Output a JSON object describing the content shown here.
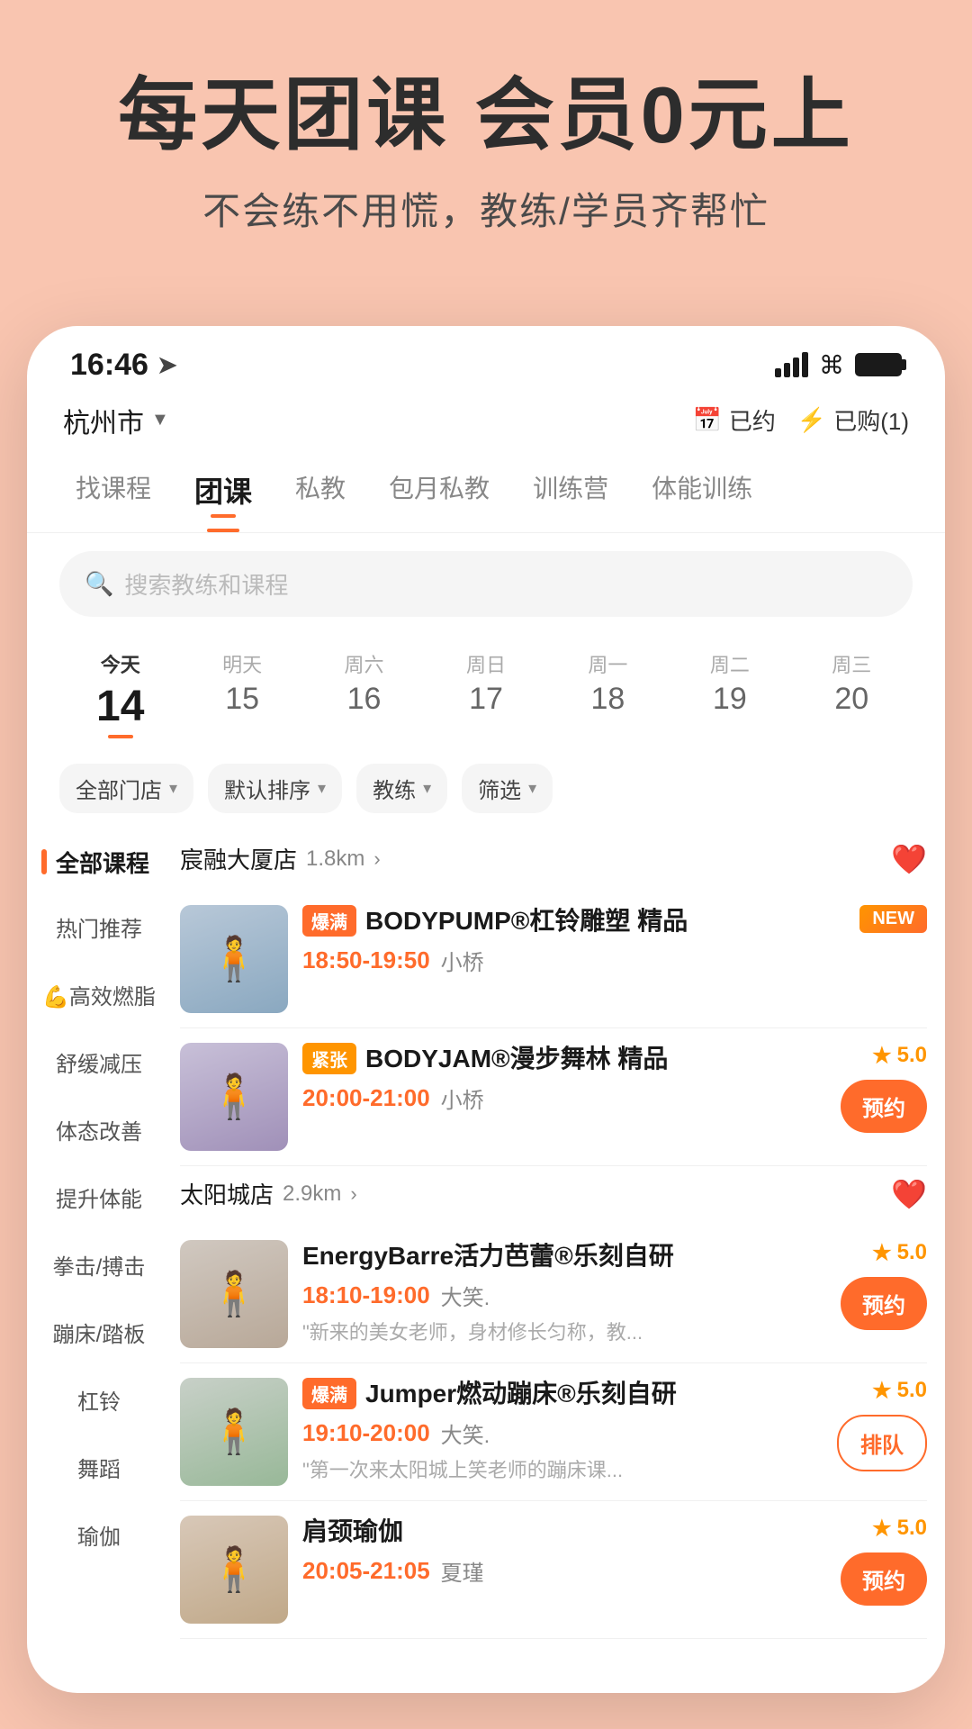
{
  "hero": {
    "title": "每天团课 会员0元上",
    "subtitle": "不会练不用慌，教练/学员齐帮忙"
  },
  "status_bar": {
    "time": "16:46",
    "nav_icon": "➤"
  },
  "top_nav": {
    "location": "杭州市",
    "booked_label": "已约",
    "purchased_label": "已购(1)"
  },
  "category_tabs": [
    {
      "label": "找课程",
      "active": false
    },
    {
      "label": "团课",
      "active": true
    },
    {
      "label": "私教",
      "active": false
    },
    {
      "label": "包月私教",
      "active": false
    },
    {
      "label": "训练营",
      "active": false
    },
    {
      "label": "体能训练",
      "active": false
    }
  ],
  "search": {
    "placeholder": "搜索教练和课程"
  },
  "dates": [
    {
      "label": "今天",
      "number": "14",
      "active": true
    },
    {
      "label": "明天",
      "number": "15",
      "active": false
    },
    {
      "label": "周六",
      "number": "16",
      "active": false
    },
    {
      "label": "周日",
      "number": "17",
      "active": false
    },
    {
      "label": "周一",
      "number": "18",
      "active": false
    },
    {
      "label": "周二",
      "number": "19",
      "active": false
    },
    {
      "label": "周三",
      "number": "20",
      "active": false
    }
  ],
  "filters": [
    {
      "label": "全部门店"
    },
    {
      "label": "默认排序"
    },
    {
      "label": "教练"
    },
    {
      "label": "筛选"
    }
  ],
  "sidebar": {
    "header": "全部课程",
    "items": [
      {
        "label": "热门推荐"
      },
      {
        "label": "💪高效燃脂"
      },
      {
        "label": "舒缓减压"
      },
      {
        "label": "体态改善"
      },
      {
        "label": "提升体能"
      },
      {
        "label": "拳击/搏击"
      },
      {
        "label": "蹦床/踏板"
      },
      {
        "label": "杠铃"
      },
      {
        "label": "舞蹈"
      },
      {
        "label": "瑜伽"
      }
    ]
  },
  "venues": [
    {
      "name": "宸融大厦店",
      "distance": "1.8km",
      "liked": true,
      "courses": [
        {
          "tag": "爆满",
          "tag_type": "hot",
          "badge": "NEW",
          "name": "BODYPUMP®杠铃雕塑 精品",
          "time": "18:50-19:50",
          "teacher": "小桥",
          "rating": null,
          "action": null,
          "thumbnail_style": "person-placeholder-1"
        },
        {
          "tag": "紧张",
          "tag_type": "tight",
          "badge": null,
          "name": "BODYJAM®漫步舞林 精品",
          "time": "20:00-21:00",
          "teacher": "小桥",
          "rating": "5.0",
          "action": "book",
          "action_label": "预约",
          "thumbnail_style": "person-placeholder-2"
        }
      ]
    },
    {
      "name": "太阳城店",
      "distance": "2.9km",
      "liked": true,
      "courses": [
        {
          "tag": null,
          "tag_type": null,
          "badge": null,
          "name": "EnergyBarre活力芭蕾®乐刻自研",
          "time": "18:10-19:00",
          "teacher": "大笑.",
          "desc": "\"新来的美女老师，身材修长匀称，教...",
          "rating": "5.0",
          "action": "book",
          "action_label": "预约",
          "thumbnail_style": "person-placeholder-3"
        },
        {
          "tag": "爆满",
          "tag_type": "hot",
          "badge": null,
          "name": "Jumper燃动蹦床®乐刻自研",
          "time": "19:10-20:00",
          "teacher": "大笑.",
          "desc": "\"第一次来太阳城上笑老师的蹦床课...",
          "rating": "5.0",
          "action": "queue",
          "action_label": "排队",
          "thumbnail_style": "person-placeholder-4"
        },
        {
          "tag": null,
          "tag_type": null,
          "badge": null,
          "name": "肩颈瑜伽",
          "time": "20:05-21:05",
          "teacher": "夏瑾",
          "rating": "5.0",
          "action": "book",
          "action_label": "预约",
          "thumbnail_style": "person-placeholder-5"
        }
      ]
    }
  ]
}
